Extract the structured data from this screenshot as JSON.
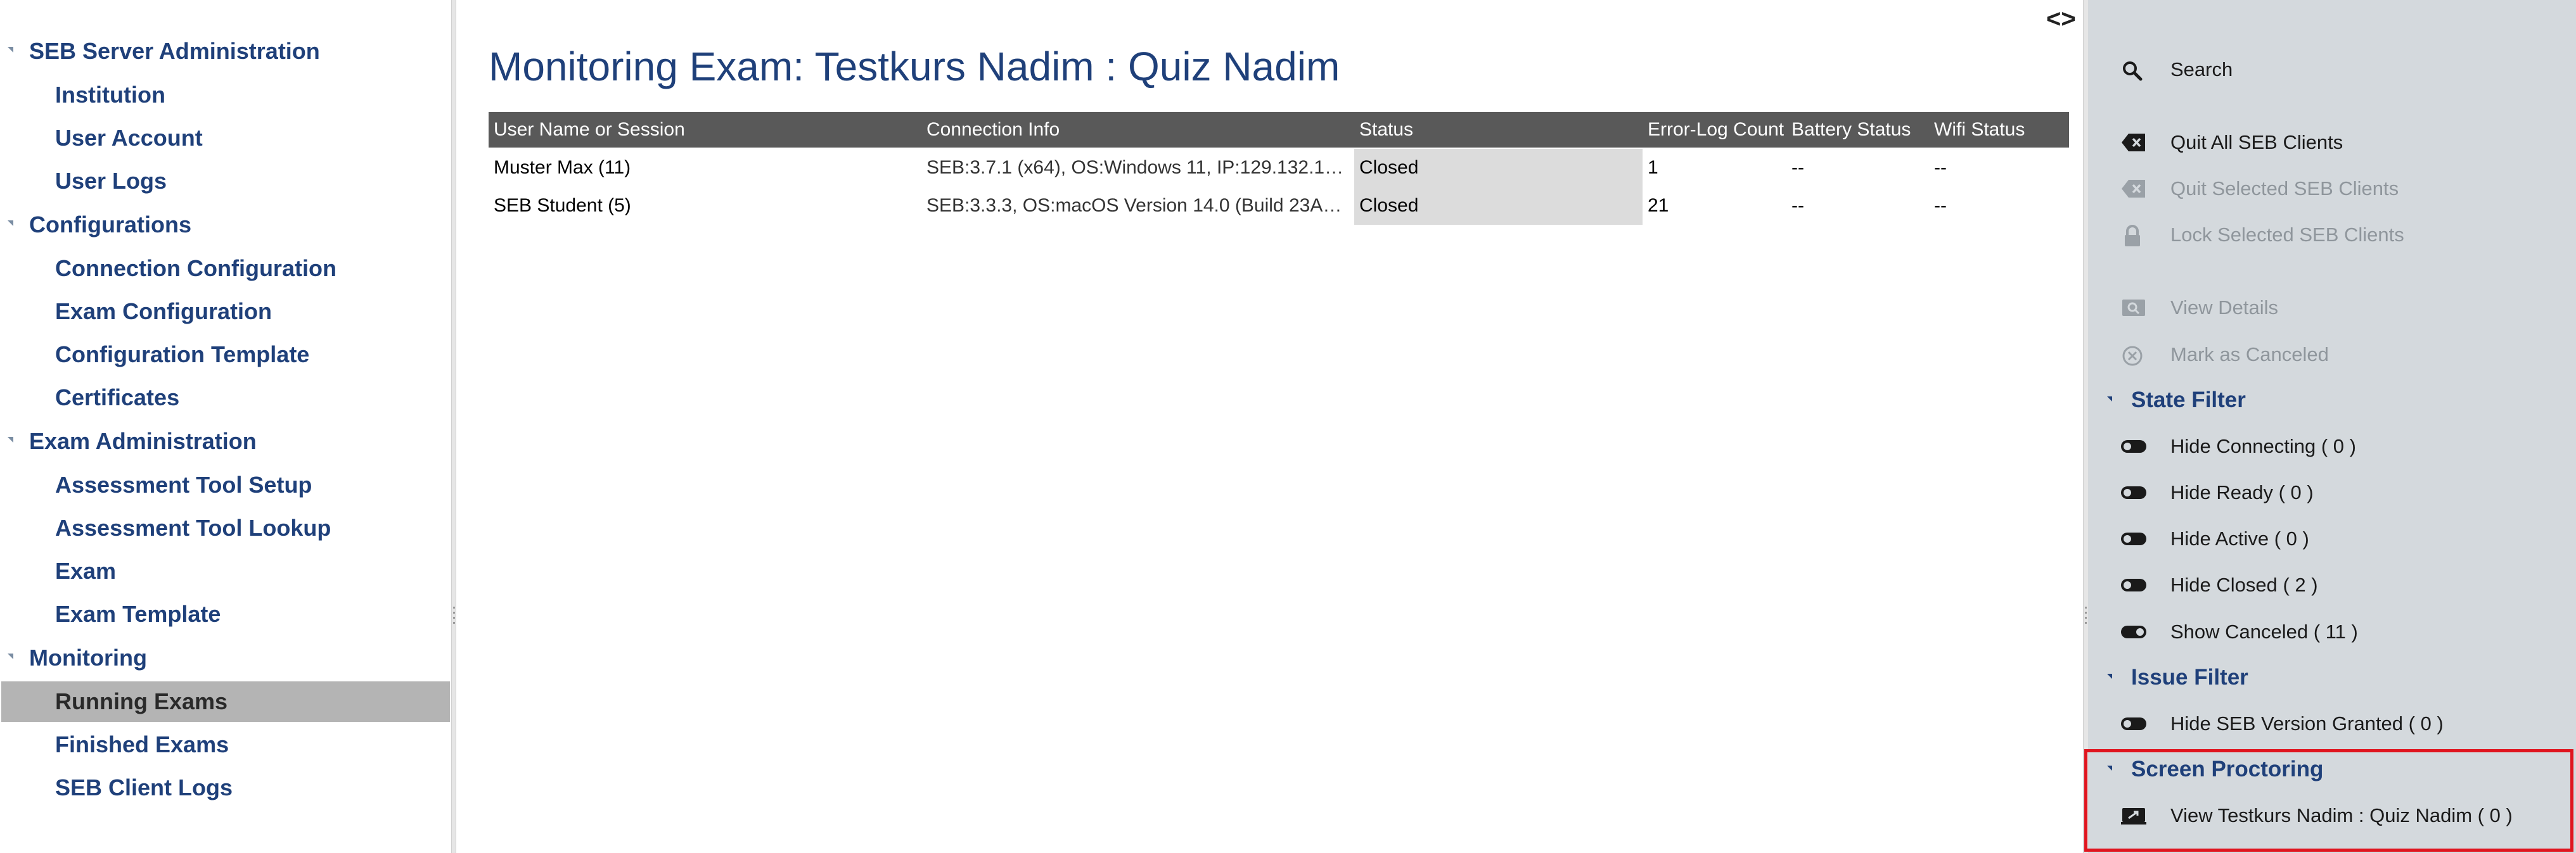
{
  "nav": {
    "groups": [
      {
        "label": "SEB Server Administration",
        "items": [
          "Institution",
          "User Account",
          "User Logs"
        ]
      },
      {
        "label": "Configurations",
        "items": [
          "Connection Configuration",
          "Exam Configuration",
          "Configuration Template",
          "Certificates"
        ]
      },
      {
        "label": "Exam Administration",
        "items": [
          "Assessment Tool Setup",
          "Assessment Tool Lookup",
          "Exam",
          "Exam Template"
        ]
      },
      {
        "label": "Monitoring",
        "items": [
          "Running Exams",
          "Finished Exams",
          "SEB Client Logs"
        ]
      }
    ],
    "active_item": "Running Exams"
  },
  "main": {
    "title": "Monitoring Exam: Testkurs Nadim : Quiz Nadim",
    "toggle_arrows": "<>",
    "table": {
      "columns": [
        "User Name or Session",
        "Connection Info",
        "Status",
        "Error-Log Count",
        "Battery Status",
        "Wifi Status"
      ],
      "rows": [
        [
          "Muster Max (11)",
          "SEB:3.7.1 (x64), OS:Windows 11, IP:129.132.1…",
          "Closed",
          "1",
          "--",
          "--"
        ],
        [
          "SEB Student (5)",
          "SEB:3.3.3, OS:macOS Version 14.0 (Build 23A…",
          "Closed",
          "21",
          "--",
          "--"
        ]
      ]
    }
  },
  "panel": {
    "search": {
      "label": "Search",
      "icon": "search-icon"
    },
    "actions": [
      {
        "label": "Quit All SEB Clients",
        "icon": "quit-icon",
        "enabled": true
      },
      {
        "label": "Quit Selected SEB Clients",
        "icon": "quit-icon",
        "enabled": false
      },
      {
        "label": "Lock Selected SEB Clients",
        "icon": "lock-icon",
        "enabled": false
      },
      {
        "label": "View Details",
        "icon": "view-details-icon",
        "enabled": false
      },
      {
        "label": "Mark as Canceled",
        "icon": "cancel-icon",
        "enabled": false
      }
    ],
    "state_filter": {
      "title": "State Filter",
      "items": [
        {
          "label": "Hide Connecting ( 0 )",
          "on": false
        },
        {
          "label": "Hide Ready ( 0 )",
          "on": false
        },
        {
          "label": "Hide Active ( 0 )",
          "on": false
        },
        {
          "label": "Hide Closed ( 2 )",
          "on": false
        },
        {
          "label": "Show Canceled ( 11 )",
          "on": true
        }
      ]
    },
    "issue_filter": {
      "title": "Issue Filter",
      "items": [
        {
          "label": "Hide SEB Version Granted ( 0 )",
          "on": false
        }
      ]
    },
    "screen_proctoring": {
      "title": "Screen Proctoring",
      "item": {
        "label": "View Testkurs Nadim : Quiz Nadim ( 0 )",
        "icon": "screen-proctoring-icon"
      }
    }
  },
  "colors": {
    "nav_text": "#1f407a",
    "active_nav_bg": "#b4b4b4",
    "table_header_bg": "#595959",
    "status_cell_bg": "#dcdcdc",
    "panel_bg": "#d4d9dd",
    "highlight": "#e0141e"
  }
}
